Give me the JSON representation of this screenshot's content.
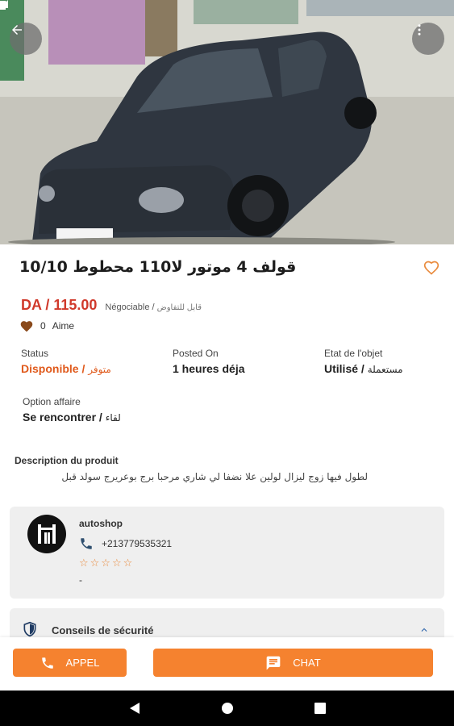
{
  "listing": {
    "title": "قولف 4 موتور لا110 محطوط 10/10",
    "price": "DA / 115.00",
    "negotiable_fr": "Négociable /",
    "negotiable_ar": "قابل للتفاوض",
    "likes_count": "0",
    "likes_label": "Aime"
  },
  "details": {
    "status_label": "Status",
    "status_value_fr": "Disponible /",
    "status_value_ar": "متوفر",
    "posted_label": "Posted On",
    "posted_value": "1 heures déja",
    "state_label": "Etat de l'objet",
    "state_value_fr": "Utilisé /",
    "state_value_ar": "مستعملة",
    "deal_label": "Option affaire",
    "deal_value_fr": "Se rencontrer /",
    "deal_value_ar": "لقاء"
  },
  "description": {
    "label": "Description du produit",
    "text": "لطول فيها زوج ليزال لولين علا نضفا لي شاري مرحبا برج بوعريرج سولد قبل"
  },
  "seller": {
    "name": "autoshop",
    "phone": "+213779535321",
    "rating_stars": "☆☆☆☆☆",
    "extra": "-"
  },
  "safety": {
    "label": "Conseils de sécurité"
  },
  "actions": {
    "call_label": "APPEL",
    "chat_label": "CHAT"
  },
  "colors": {
    "accent": "#f5822f",
    "price": "#d0392b",
    "status": "#e05a1c"
  },
  "icons": [
    "back-arrow-icon",
    "more-vert-icon",
    "heart-outline-icon",
    "heart-filled-icon",
    "phone-icon",
    "shield-icon",
    "chevron-up-icon",
    "chat-icon",
    "nav-back-icon",
    "nav-home-icon",
    "nav-recents-icon"
  ]
}
